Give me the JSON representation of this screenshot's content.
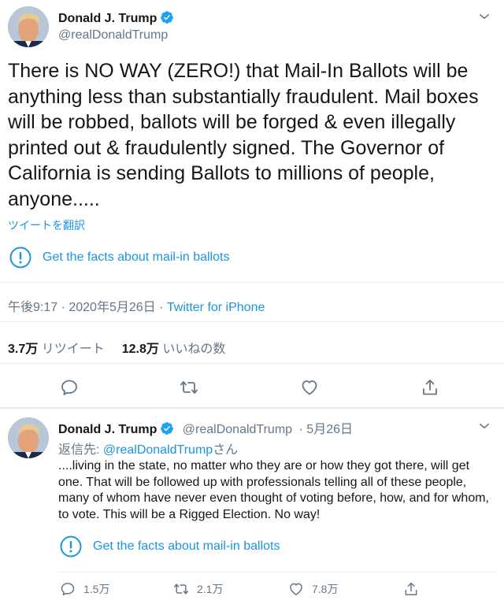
{
  "main_tweet": {
    "display_name": "Donald J. Trump",
    "handle": "@realDonaldTrump",
    "text": "There is NO WAY (ZERO!) that Mail-In Ballots will be anything less than substantially fraudulent. Mail boxes will be robbed, ballots will be forged & even illegally printed out & fraudulently signed. The Governor of California is sending Ballots to millions of people, anyone.....",
    "translate_label": "ツイートを翻訳",
    "facts_label": "Get the facts about mail-in ballots",
    "time": "午後9:17 · 2020年5月26日",
    "separator": " · ",
    "source": "Twitter for iPhone",
    "retweets_count": "3.7万",
    "retweets_label": "リツイート",
    "likes_count": "12.8万",
    "likes_label": "いいねの数"
  },
  "reply_tweet": {
    "display_name": "Donald J. Trump",
    "handle": "@realDonaldTrump",
    "date": "· 5月26日",
    "replying_prefix": "返信先: ",
    "replying_handle": "@realDonaldTrump",
    "replying_suffix": "さん",
    "text": "....living in the state, no matter who they are or how they got there, will get one. That will be followed up with professionals telling all of these people, many of whom have never even thought of voting before, how, and for whom, to vote. This will be a Rigged Election. No way!",
    "facts_label": "Get the facts about mail-in ballots",
    "replies": "1.5万",
    "retweets": "2.1万",
    "likes": "7.8万"
  },
  "colors": {
    "accent": "#1b95e0",
    "text": "#14171a",
    "secondary": "#657786",
    "divider": "#e6ecf0"
  },
  "icons": [
    "verified-badge-icon",
    "chevron-down-icon",
    "info-icon",
    "reply-icon",
    "retweet-icon",
    "like-icon",
    "share-icon"
  ]
}
